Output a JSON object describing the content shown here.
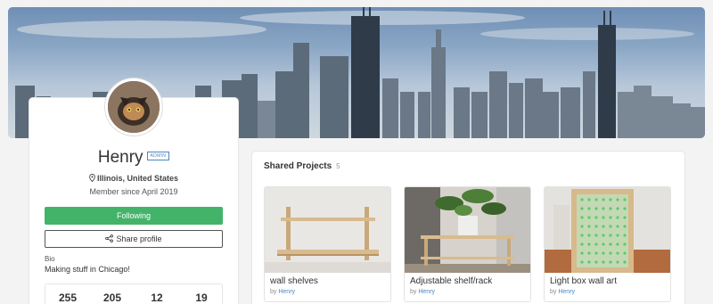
{
  "profile": {
    "name": "Henry",
    "role_badge": "ADMIN",
    "location": "Illinois, United States",
    "member_since": "Member since April 2019",
    "follow_button": "Following",
    "share_button": "Share profile",
    "bio_label": "Bio",
    "bio_text": "Making stuff in Chicago!",
    "stats": [
      "255",
      "205",
      "12",
      "19"
    ]
  },
  "projects": {
    "title": "Shared Projects",
    "count": "5",
    "by_label": "by",
    "items": [
      {
        "title": "wall shelves",
        "author": "Henry"
      },
      {
        "title": "Adjustable shelf/rack",
        "author": "Henry"
      },
      {
        "title": "Light box wall art",
        "author": "Henry"
      }
    ]
  },
  "colors": {
    "accent_green": "#44b36a",
    "link_blue": "#4a86c5"
  },
  "icons": {
    "location": "map-pin-icon",
    "share": "share-icon"
  }
}
